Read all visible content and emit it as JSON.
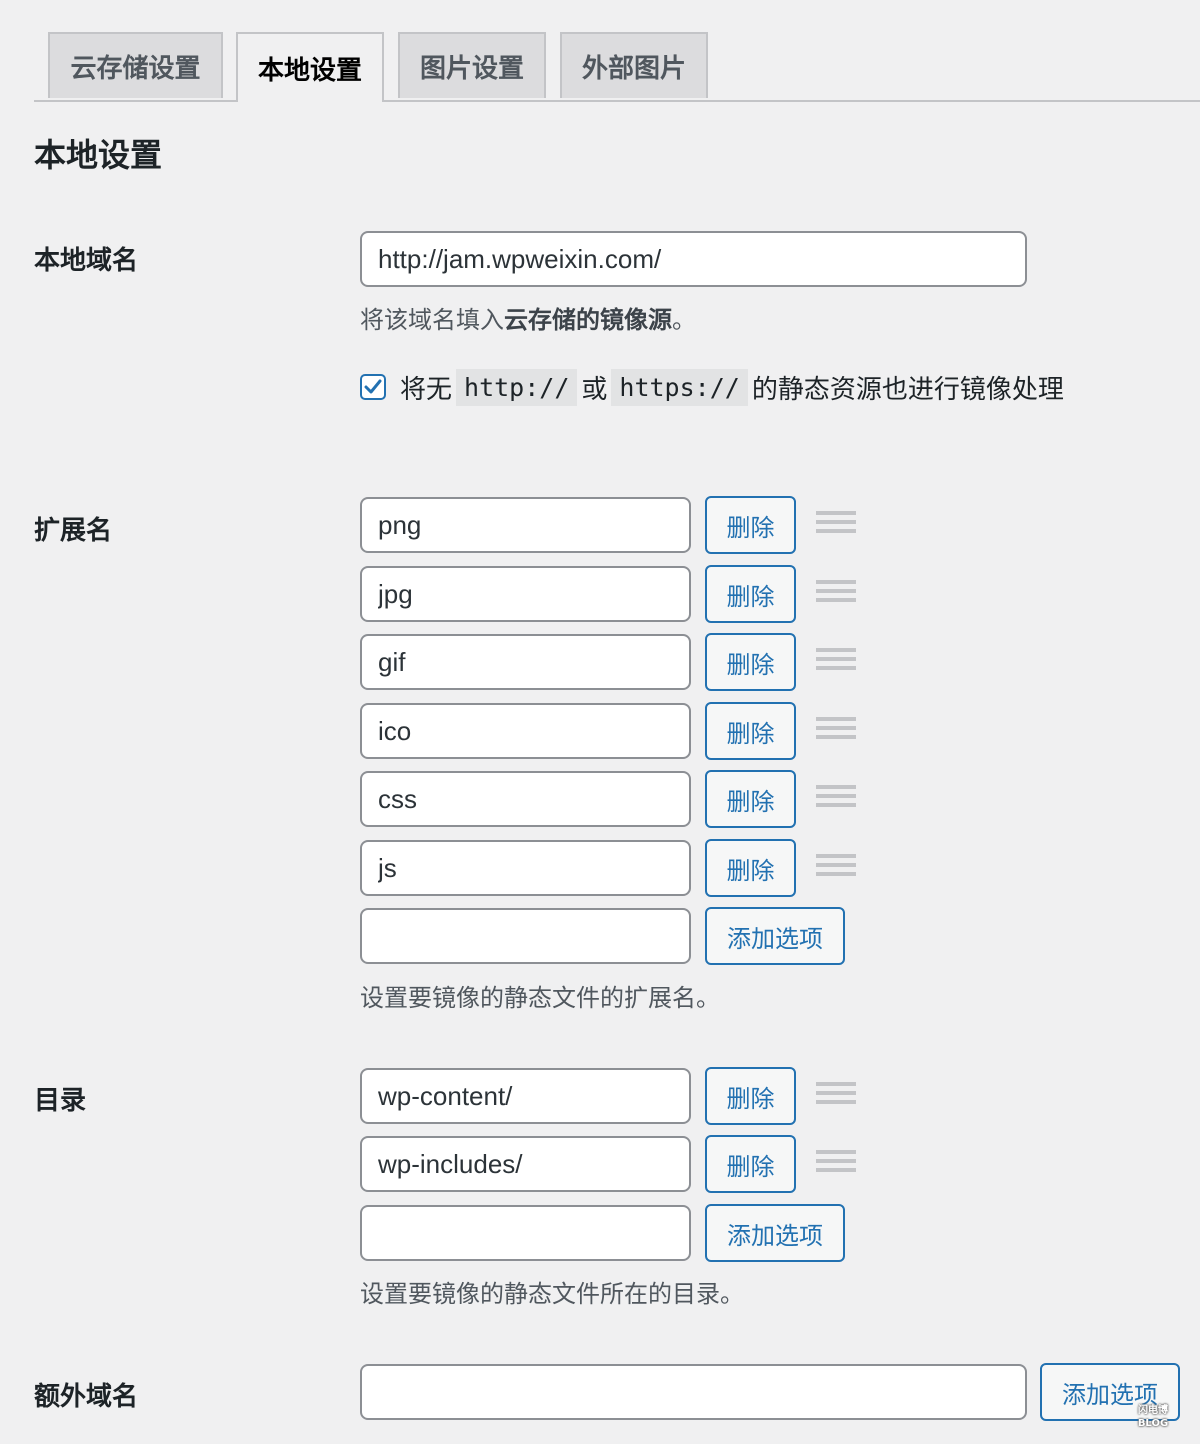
{
  "tabs": [
    {
      "label": "云存储设置",
      "active": false
    },
    {
      "label": "本地设置",
      "active": true
    },
    {
      "label": "图片设置",
      "active": false
    },
    {
      "label": "外部图片",
      "active": false
    }
  ],
  "section_title": "本地设置",
  "local_domain": {
    "label": "本地域名",
    "value": "http://jam.wpweixin.com/",
    "description_prefix": "将该域名填入",
    "description_emphasis": "云存储的镜像源",
    "description_suffix": "。",
    "checkbox": {
      "checked": true,
      "text_before": "将无",
      "code_1": "http://",
      "text_mid": "或",
      "code_2": "https://",
      "text_after": "的静态资源也进行镜像处理"
    }
  },
  "extensions": {
    "label": "扩展名",
    "items": [
      "png",
      "jpg",
      "gif",
      "ico",
      "css",
      "js"
    ],
    "new_value": "",
    "delete_label": "删除",
    "add_label": "添加选项",
    "description": "设置要镜像的静态文件的扩展名。"
  },
  "directories": {
    "label": "目录",
    "items": [
      "wp-content/",
      "wp-includes/"
    ],
    "new_value": "",
    "delete_label": "删除",
    "add_label": "添加选项",
    "description": "设置要镜像的静态文件所在的目录。"
  },
  "extra_domains": {
    "label": "额外域名",
    "value": "",
    "add_label": "添加选项"
  },
  "watermark": {
    "line1": "闪电博",
    "line2": "BLOG"
  },
  "colors": {
    "background": "#f0f0f1",
    "accent": "#2271b1",
    "tab_inactive": "#dcdcde",
    "border": "#8c8f94"
  }
}
